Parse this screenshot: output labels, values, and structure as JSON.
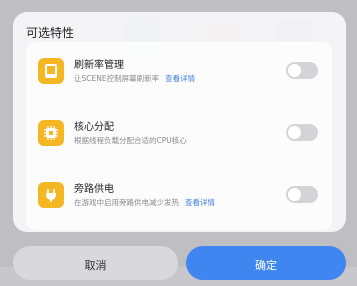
{
  "dialog": {
    "title": "可选特性",
    "items": [
      {
        "title": "刷新率管理",
        "desc": "让SCENE控制屏幕刷新率",
        "link": "查看详情",
        "enabled": false,
        "icon": "display-icon"
      },
      {
        "title": "核心分配",
        "desc": "根据线程负载分配合适的CPU核心",
        "link": "",
        "enabled": false,
        "icon": "cpu-icon"
      },
      {
        "title": "旁路供电",
        "desc": "在游戏中启用旁路供电减少发热",
        "link": "查看详情",
        "enabled": false,
        "icon": "plug-icon"
      }
    ],
    "cancel_label": "取消",
    "confirm_label": "确定"
  },
  "colors": {
    "accent": "#3f86f0",
    "icon_bg": "#f4b623",
    "link": "#3f7fe0"
  }
}
